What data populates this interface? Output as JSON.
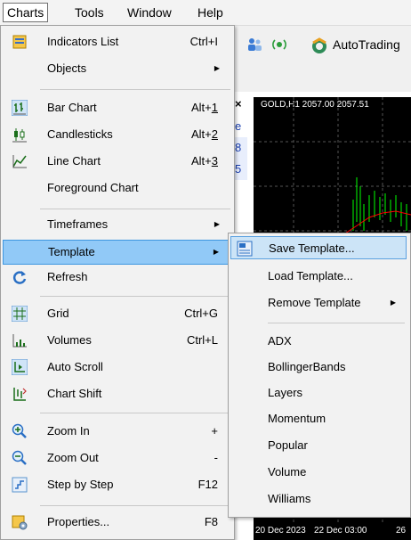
{
  "menubar": {
    "items": [
      "Charts",
      "Tools",
      "Window",
      "Help"
    ]
  },
  "toolbar": {
    "autotrading_label": "AutoTrading"
  },
  "chart": {
    "title": "GOLD,H1  2057.00 2057.51",
    "x_labels": [
      "20 Dec 2023",
      "22 Dec 03:00",
      "26"
    ],
    "side_values": [
      "e",
      "8",
      "5"
    ]
  },
  "charts_menu": {
    "items": [
      {
        "label": "Indicators List",
        "shortcut": "Ctrl+I",
        "icon": "indicators-list-icon"
      },
      {
        "label": "Objects",
        "submenu": true
      },
      {
        "label": "Bar Chart",
        "shortcut_prefix": "Alt+",
        "shortcut_key": "1",
        "icon": "bar-chart-icon"
      },
      {
        "label": "Candlesticks",
        "shortcut_prefix": "Alt+",
        "shortcut_key": "2",
        "icon": "candlesticks-icon"
      },
      {
        "label": "Line Chart",
        "shortcut_prefix": "Alt+",
        "shortcut_key": "3",
        "icon": "line-chart-icon"
      },
      {
        "label": "Foreground Chart"
      },
      {
        "label": "Timeframes",
        "submenu": true
      },
      {
        "label": "Template",
        "submenu": true,
        "highlighted": true
      },
      {
        "label": "Refresh",
        "icon": "refresh-icon"
      },
      {
        "label": "Grid",
        "shortcut": "Ctrl+G",
        "icon": "grid-icon"
      },
      {
        "label": "Volumes",
        "shortcut": "Ctrl+L",
        "icon": "volumes-icon"
      },
      {
        "label": "Auto Scroll",
        "icon": "auto-scroll-icon"
      },
      {
        "label": "Chart Shift",
        "icon": "chart-shift-icon"
      },
      {
        "label": "Zoom In",
        "shortcut": "+",
        "icon": "zoom-in-icon"
      },
      {
        "label": "Zoom Out",
        "shortcut": "-",
        "icon": "zoom-out-icon"
      },
      {
        "label": "Step by Step",
        "shortcut": "F12",
        "icon": "step-by-step-icon"
      },
      {
        "label": "Properties...",
        "shortcut": "F8",
        "icon": "properties-icon"
      }
    ]
  },
  "template_menu": {
    "items": [
      {
        "label": "Save Template...",
        "icon": "save-template-icon",
        "highlighted": true
      },
      {
        "label": "Load Template..."
      },
      {
        "label": "Remove Template",
        "submenu": true
      },
      {
        "label": "ADX"
      },
      {
        "label": "BollingerBands"
      },
      {
        "label": "Layers"
      },
      {
        "label": "Momentum"
      },
      {
        "label": "Popular"
      },
      {
        "label": "Volume"
      },
      {
        "label": "Williams"
      }
    ]
  },
  "colors": {
    "highlight": "#91c9f7",
    "highlight_border": "#3d96e0",
    "chart_bg": "#000000",
    "candle_green": "#00ff00",
    "ma_red": "#ff0000"
  }
}
